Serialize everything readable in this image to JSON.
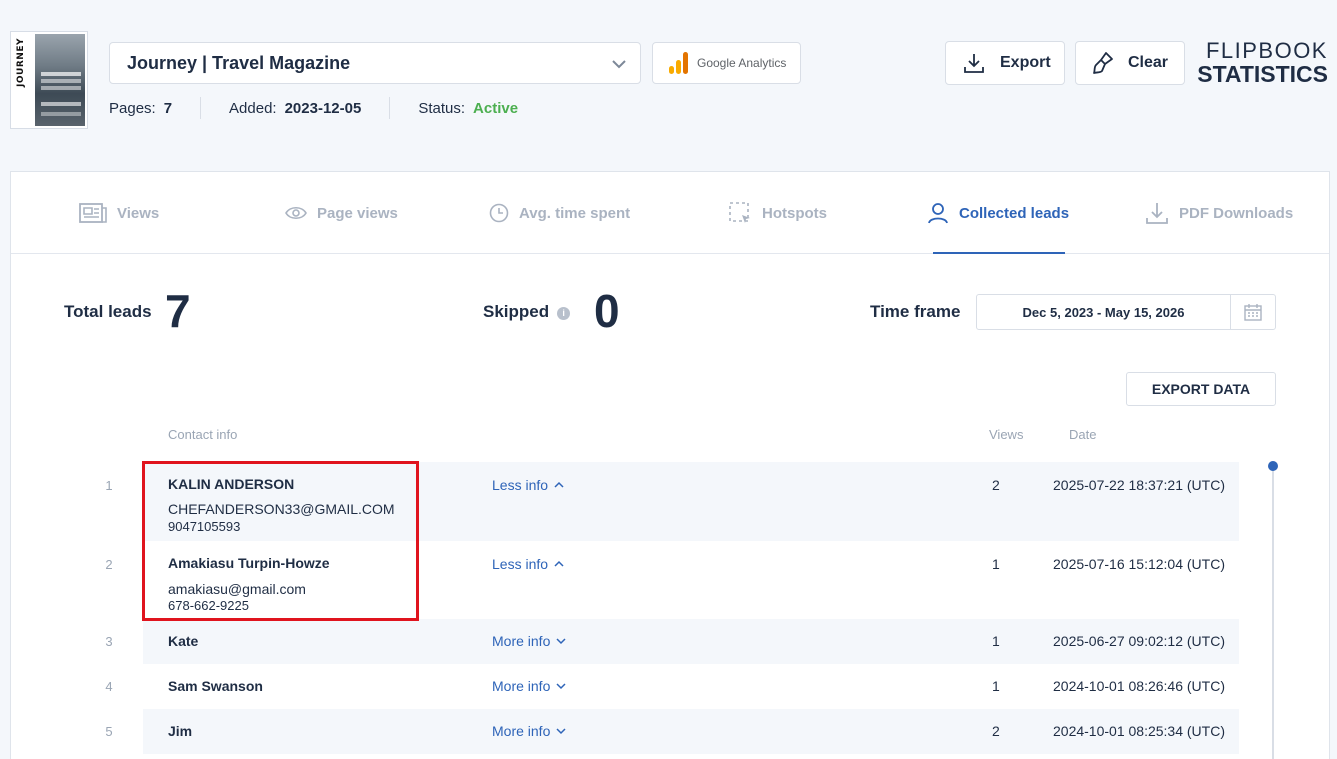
{
  "publication": {
    "thumbnail_title": "JOURNEY",
    "selected": "Journey | Travel Magazine",
    "pages_label": "Pages:",
    "pages_value": "7",
    "added_label": "Added:",
    "added_value": "2023-12-05",
    "status_label": "Status:",
    "status_value": "Active"
  },
  "google_analytics": {
    "label": "Google Analytics"
  },
  "toolbar": {
    "export_label": "Export",
    "clear_label": "Clear"
  },
  "brand": {
    "line1": "FLIPBOOK",
    "line2": "STATISTICS"
  },
  "tabs": [
    {
      "label": "Views",
      "icon": "newspaper-icon",
      "active": false
    },
    {
      "label": "Page views",
      "icon": "eye-icon",
      "active": false
    },
    {
      "label": "Avg. time spent",
      "icon": "clock-icon",
      "active": false
    },
    {
      "label": "Hotspots",
      "icon": "hotspot-icon",
      "active": false
    },
    {
      "label": "Collected leads",
      "icon": "user-icon",
      "active": true
    },
    {
      "label": "PDF Downloads",
      "icon": "download-icon",
      "active": false
    }
  ],
  "stats": {
    "total_leads_label": "Total leads",
    "total_leads_value": "7",
    "skipped_label": "Skipped",
    "skipped_info": "i",
    "skipped_value": "0",
    "timeframe_label": "Time frame",
    "timeframe_value": "Dec 5, 2023 - May 15, 2026"
  },
  "export_data_label": "EXPORT DATA",
  "table": {
    "headers": {
      "contact": "Contact info",
      "views": "Views",
      "date": "Date"
    },
    "rows": [
      {
        "num": "1",
        "name": "KALIN ANDERSON",
        "email": "CHEFANDERSON33@GMAIL.COM",
        "phone": "9047105593",
        "toggle": "Less info",
        "views": "2",
        "date": "2025-07-22 18:37:21 (UTC)"
      },
      {
        "num": "2",
        "name": "Amakiasu Turpin-Howze",
        "email": "amakiasu@gmail.com",
        "phone": "678-662-9225",
        "toggle": "Less info",
        "views": "1",
        "date": "2025-07-16 15:12:04 (UTC)"
      },
      {
        "num": "3",
        "name": "Kate",
        "toggle": "More info",
        "views": "1",
        "date": "2025-06-27 09:02:12 (UTC)"
      },
      {
        "num": "4",
        "name": "Sam Swanson",
        "toggle": "More info",
        "views": "1",
        "date": "2024-10-01 08:26:46 (UTC)"
      },
      {
        "num": "5",
        "name": "Jim",
        "toggle": "More info",
        "views": "2",
        "date": "2024-10-01 08:25:34 (UTC)"
      }
    ]
  },
  "colors": {
    "accent": "#2e64b8",
    "active_status": "#4caf50",
    "highlight": "#e0141e"
  }
}
